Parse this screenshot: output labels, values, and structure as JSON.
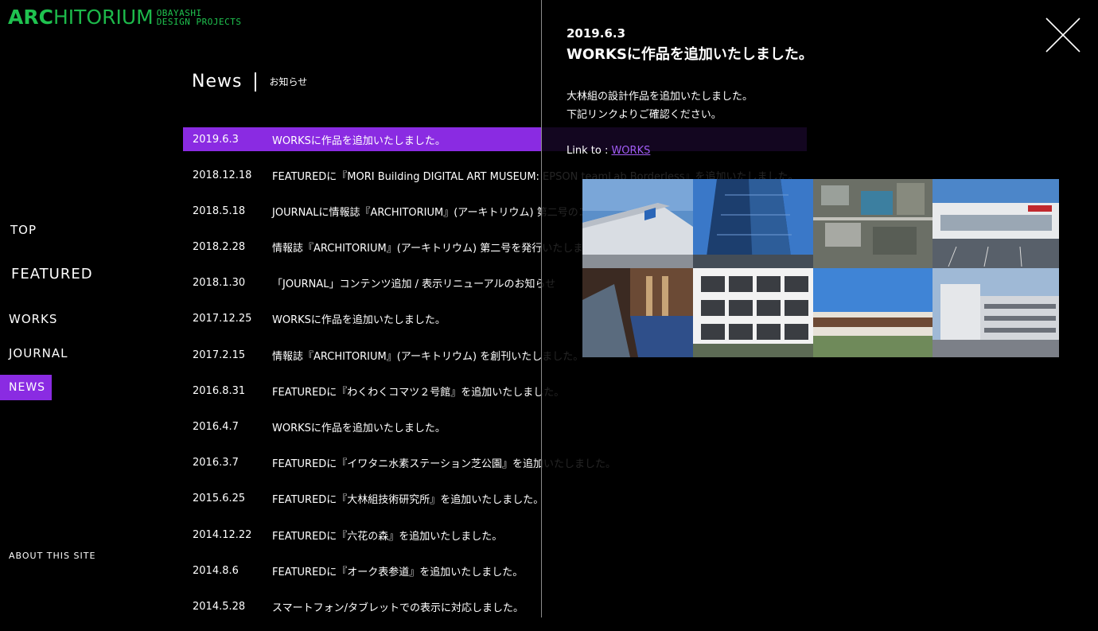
{
  "logo": {
    "main_bold": "ARC",
    "main_thin": "HITORIUM",
    "sub_line1": "OBAYASHI",
    "sub_line2": "DESIGN PROJECTS",
    "color": "#1fc24f"
  },
  "nav": {
    "top": "TOP",
    "featured": "FEATURED",
    "works": "WORKS",
    "journal": "JOURNAL",
    "news": "NEWS",
    "about": "ABOUT THIS SITE",
    "active_color": "#8a2be2"
  },
  "news_page": {
    "title": "News",
    "subtitle": "お知らせ",
    "items": [
      {
        "date": "2019.6.3",
        "text": "WORKSに作品を追加いたしました。",
        "active": true
      },
      {
        "date": "2018.12.18",
        "text": "FEATUREDに『MORI Building DIGITAL ART MUSEUM: EPSON teamLab Borderless』を追加いたしました。"
      },
      {
        "date": "2018.5.18",
        "text": "JOURNALに情報誌『ARCHITORIUM』(アーキトリウム) 第二号のコンテンツを追加いたしました。"
      },
      {
        "date": "2018.2.28",
        "text": "情報誌『ARCHITORIUM』(アーキトリウム) 第二号を発行いたしました。"
      },
      {
        "date": "2018.1.30",
        "text": "「JOURNAL」コンテンツ追加 / 表示リニューアルのお知らせ"
      },
      {
        "date": "2017.12.25",
        "text": "WORKSに作品を追加いたしました。"
      },
      {
        "date": "2017.2.15",
        "text": "情報誌『ARCHITORIUM』(アーキトリウム) を創刊いたしました。"
      },
      {
        "date": "2016.8.31",
        "text": "FEATUREDに『わくわくコマツ２号館』を追加いたしました。"
      },
      {
        "date": "2016.4.7",
        "text": "WORKSに作品を追加いたしました。"
      },
      {
        "date": "2016.3.7",
        "text": "FEATUREDに『イワタニ水素ステーション芝公園』を追加いたしました。"
      },
      {
        "date": "2015.6.25",
        "text": "FEATUREDに『大林組技術研究所』を追加いたしました。"
      },
      {
        "date": "2014.12.22",
        "text": "FEATUREDに『六花の森』を追加いたしました。"
      },
      {
        "date": "2014.8.6",
        "text": "FEATUREDに『オーク表参道』を追加いたしました。"
      },
      {
        "date": "2014.5.28",
        "text": "スマートフォン/タブレットでの表示に対応しました。"
      }
    ]
  },
  "detail": {
    "date": "2019.6.3",
    "title": "WORKSに作品を追加いたしました。",
    "body_line1": "大林組の設計作品を追加いたしました。",
    "body_line2": "下記リンクよりご確認ください。",
    "link_prefix": "Link to : ",
    "link_label": "WORKS",
    "link_color": "#a15cf5",
    "close_icon": "close-icon"
  }
}
